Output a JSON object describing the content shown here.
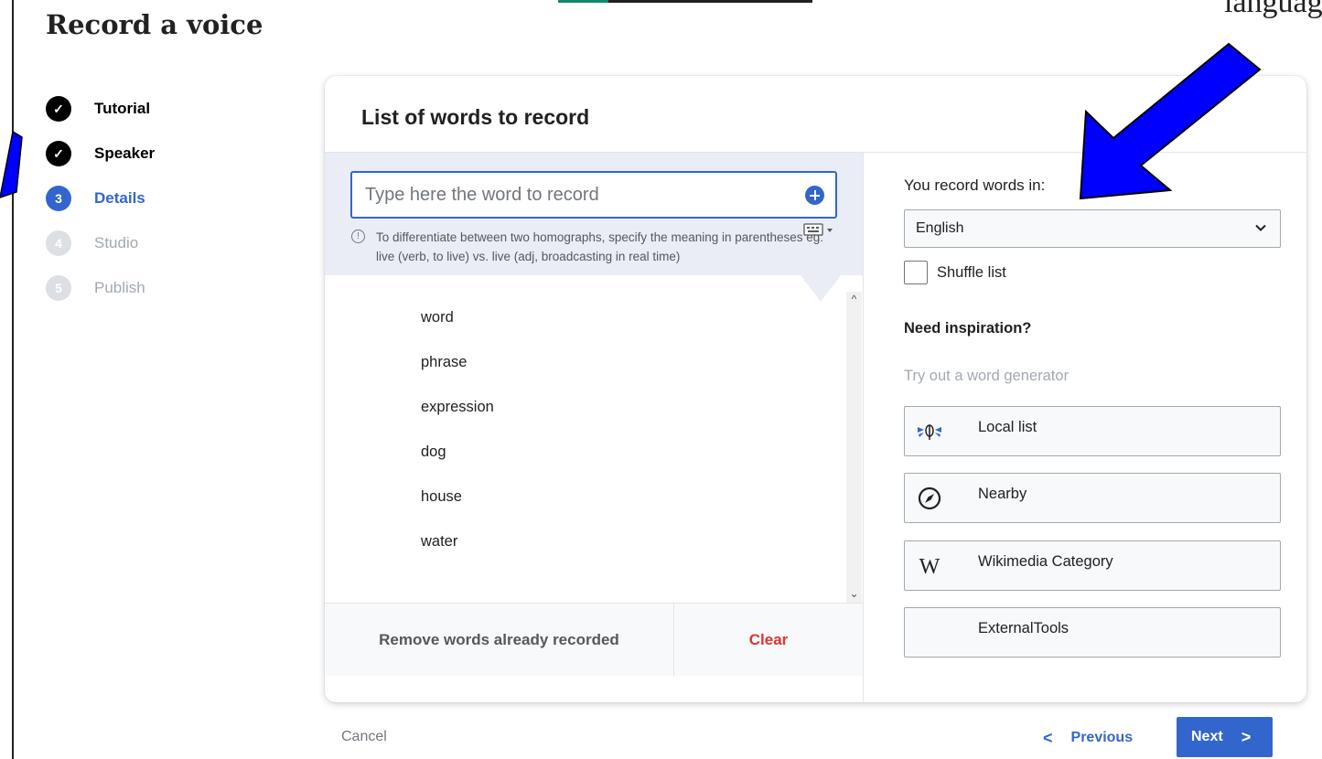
{
  "header": {
    "title": "Record a voice"
  },
  "annotation": {
    "text": "language"
  },
  "steps": [
    {
      "number": "✓",
      "label": "Tutorial",
      "state": "done"
    },
    {
      "number": "✓",
      "label": "Speaker",
      "state": "done"
    },
    {
      "number": "3",
      "label": "Details",
      "state": "current"
    },
    {
      "number": "4",
      "label": "Studio",
      "state": "todo"
    },
    {
      "number": "5",
      "label": "Publish",
      "state": "todo"
    }
  ],
  "card": {
    "title": "List of words to record",
    "input": {
      "placeholder": "Type here the word to record",
      "hint": "To differentiate between two homographs, specify the meaning in parentheses eg: live (verb, to live) vs. live (adj, broadcasting in real time)"
    },
    "words": [
      "word",
      "phrase",
      "expression",
      "dog",
      "house",
      "water"
    ],
    "remove_label": "Remove words already recorded",
    "clear_label": "Clear",
    "language_label": "You record words in:",
    "language_value": "English",
    "shuffle_label": "Shuffle list",
    "inspiration_title": "Need inspiration?",
    "inspiration_subtitle": "Try out a word generator",
    "generators": [
      {
        "label": "Local list",
        "icon": "lingualibre-icon"
      },
      {
        "label": "Nearby",
        "icon": "compass-icon"
      },
      {
        "label": "Wikimedia Category",
        "icon": "wikipedia-w-icon"
      },
      {
        "label": "ExternalTools",
        "icon": "none"
      }
    ]
  },
  "footer": {
    "cancel_label": "Cancel",
    "previous_label": "Previous",
    "next_label": "Next"
  },
  "colors": {
    "accent": "#3366cc",
    "destructive": "#d33333",
    "annotation_arrow": "#0000ff"
  }
}
